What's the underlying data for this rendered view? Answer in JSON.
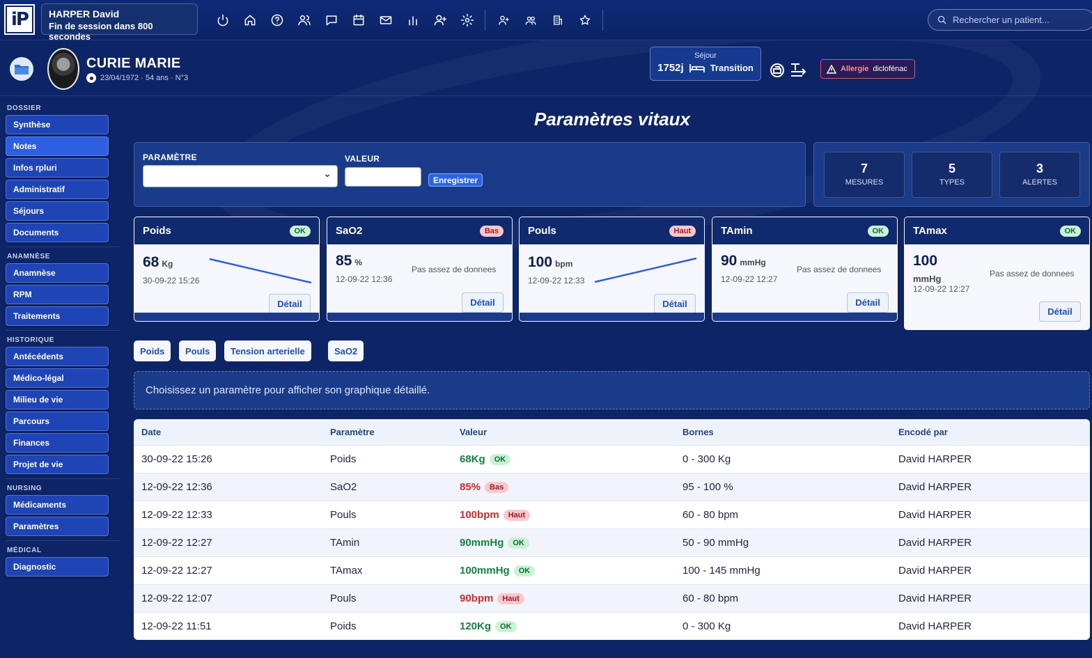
{
  "topbar": {
    "logo": "iP",
    "user": "HARPER David",
    "session": "Fin de session dans 800 secondes",
    "search_placeholder": "Rechercher un patient..."
  },
  "patient": {
    "name": "CURIE MARIE",
    "info": "23/04/1972 · 54 ans · N°3",
    "sejour_label": "Séjour",
    "sejour_days": "1752j",
    "sejour_status": "Transition",
    "allergy_label": "Allergie",
    "allergy_value": "diclofénac"
  },
  "sidebar": {
    "sections": [
      {
        "title": "DOSSIER",
        "items": [
          "Synthèse",
          "Notes",
          "Infos rpluri",
          "Administratif",
          "Séjours",
          "Documents"
        ]
      },
      {
        "title": "ANAMNÈSE",
        "items": [
          "Anamnèse",
          "RPM",
          "Traitements"
        ]
      },
      {
        "title": "HISTORIQUE",
        "items": [
          "Antécédents",
          "Médico-légal",
          "Milieu de vie",
          "Parcours",
          "Finances",
          "Projet de vie"
        ]
      },
      {
        "title": "NURSING",
        "items": [
          "Médicaments",
          "Paramètres"
        ]
      },
      {
        "title": "MÉDICAL",
        "items": [
          "Diagnostic"
        ]
      }
    ],
    "active": "Notes"
  },
  "main": {
    "title": "Paramètres vitaux",
    "form": {
      "param_label": "PARAMÈTRE",
      "value_label": "VALEUR",
      "save_label": "Enregistrer"
    },
    "stats": [
      {
        "value": "7",
        "label": "MESURES"
      },
      {
        "value": "5",
        "label": "TYPES"
      },
      {
        "value": "3",
        "label": "ALERTES"
      }
    ],
    "cards": [
      {
        "name": "Poids",
        "badge": "OK",
        "value": "68",
        "unit": "Kg",
        "date": "30-09-22 15:26",
        "nodata": "",
        "detail": "Détail"
      },
      {
        "name": "SaO2",
        "badge": "Bas",
        "value": "85",
        "unit": "%",
        "date": "12-09-22 12:36",
        "nodata": "Pas assez de donnees",
        "detail": "Détail"
      },
      {
        "name": "Pouls",
        "badge": "Haut",
        "value": "100",
        "unit": "bpm",
        "date": "12-09-22 12:33",
        "nodata": "",
        "detail": "Détail"
      },
      {
        "name": "TAmin",
        "badge": "OK",
        "value": "90",
        "unit": "mmHg",
        "date": "12-09-22 12:27",
        "nodata": "Pas assez de donnees",
        "detail": "Détail"
      },
      {
        "name": "TAmax",
        "badge": "OK",
        "value": "100",
        "unit": "mmHg",
        "date": "12-09-22 12:27",
        "nodata": "Pas assez de donnees",
        "detail": "Détail"
      }
    ],
    "chips": [
      "Poids",
      "Pouls",
      "Tension arterielle",
      "SaO2"
    ],
    "hint": "Choisissez un paramètre pour afficher son graphique détaillé.",
    "table": {
      "headers": [
        "Date",
        "Paramètre",
        "Valeur",
        "Bornes",
        "Encodé par"
      ],
      "rows": [
        {
          "date": "30-09-22 15:26",
          "param": "Poids",
          "value": "68Kg",
          "status": "OK",
          "range": "0 - 300 Kg",
          "by": "David HARPER"
        },
        {
          "date": "12-09-22 12:36",
          "param": "SaO2",
          "value": "85%",
          "status": "Bas",
          "range": "95 - 100 %",
          "by": "David HARPER"
        },
        {
          "date": "12-09-22 12:33",
          "param": "Pouls",
          "value": "100bpm",
          "status": "Haut",
          "range": "60 - 80 bpm",
          "by": "David HARPER"
        },
        {
          "date": "12-09-22 12:27",
          "param": "TAmin",
          "value": "90mmHg",
          "status": "OK",
          "range": "50 - 90 mmHg",
          "by": "David HARPER"
        },
        {
          "date": "12-09-22 12:27",
          "param": "TAmax",
          "value": "100mmHg",
          "status": "OK",
          "range": "100 - 145 mmHg",
          "by": "David HARPER"
        },
        {
          "date": "12-09-22 12:07",
          "param": "Pouls",
          "value": "90bpm",
          "status": "Haut",
          "range": "60 - 80 bpm",
          "by": "David HARPER"
        },
        {
          "date": "12-09-22 11:51",
          "param": "Poids",
          "value": "120Kg",
          "status": "OK",
          "range": "0 - 300 Kg",
          "by": "David HARPER"
        }
      ]
    }
  },
  "colors": {
    "accent": "#2d5fe0",
    "ok": "#138140",
    "alert": "#d22a2a",
    "bg": "#0d2466"
  },
  "icons": [
    "power-icon",
    "home-icon",
    "help-icon",
    "users-icon",
    "chat-icon",
    "calendar-icon",
    "mail-icon",
    "chart-icon",
    "user-add-icon",
    "gear-icon",
    "person-plus-icon",
    "group-icon",
    "building-icon",
    "star-icon"
  ]
}
